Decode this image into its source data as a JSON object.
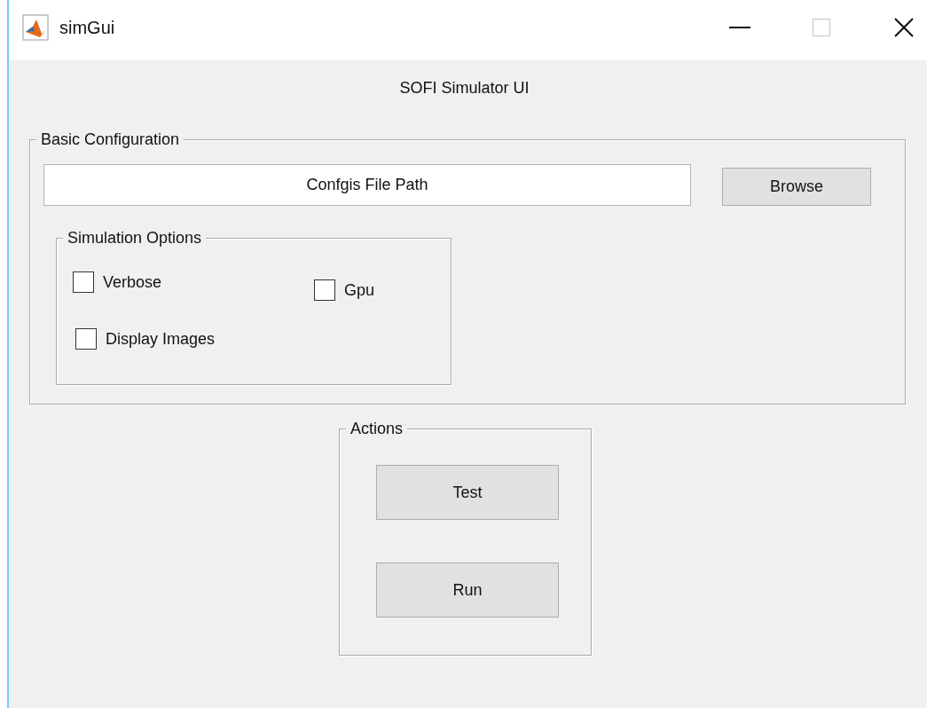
{
  "window": {
    "title": "simGui",
    "maximize_enabled": false
  },
  "heading": "SOFI Simulator UI",
  "basic_configuration": {
    "title": "Basic Configuration",
    "path_field": {
      "value": "Confgis File Path"
    },
    "browse_button": "Browse",
    "simulation_options": {
      "title": "Simulation Options",
      "options": [
        {
          "label": "Verbose",
          "checked": false
        },
        {
          "label": "Gpu",
          "checked": false
        },
        {
          "label": "Display Images",
          "checked": false
        }
      ]
    }
  },
  "actions": {
    "title": "Actions",
    "buttons": [
      "Test",
      "Run"
    ]
  }
}
